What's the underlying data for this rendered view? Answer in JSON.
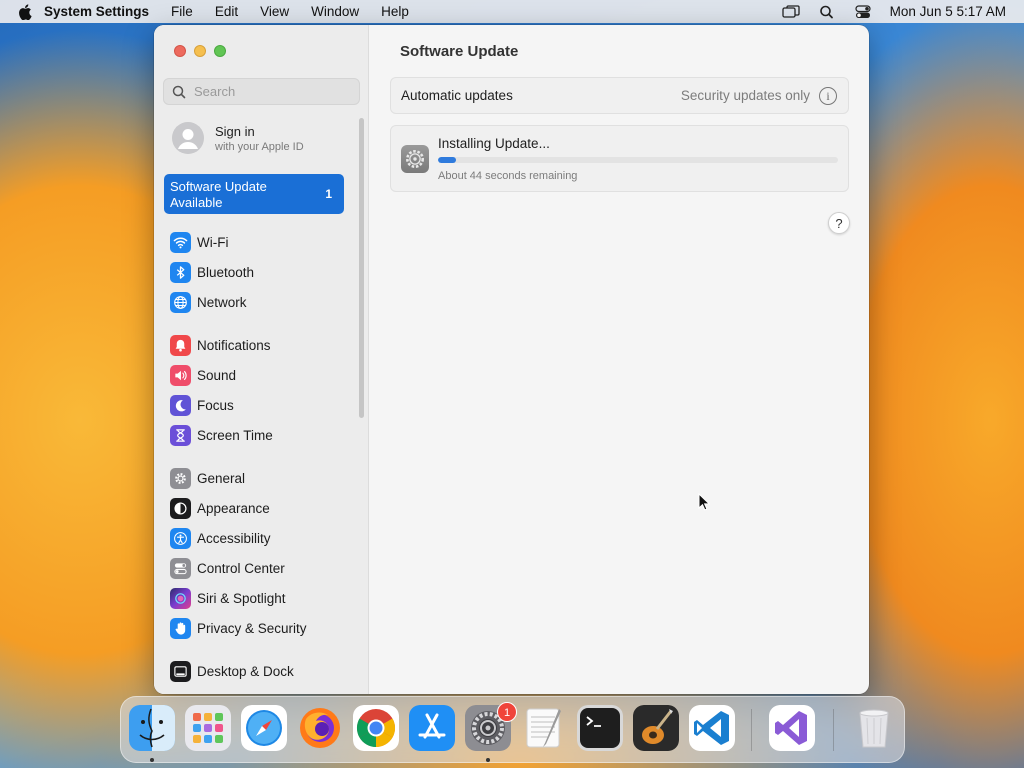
{
  "menubar": {
    "app_name": "System Settings",
    "menus": [
      "File",
      "Edit",
      "View",
      "Window",
      "Help"
    ],
    "clock": "Mon Jun 5  5:17 AM"
  },
  "sidebar": {
    "search_placeholder": "Search",
    "signin_title": "Sign in",
    "signin_subtitle": "with your Apple ID",
    "update_label_line1": "Software Update",
    "update_label_line2": "Available",
    "update_badge": "1",
    "items": [
      {
        "label": "Wi-Fi",
        "icon": "wifi-icon",
        "color": "#1f86f0"
      },
      {
        "label": "Bluetooth",
        "icon": "bluetooth-icon",
        "color": "#1f86f0"
      },
      {
        "label": "Network",
        "icon": "globe-icon",
        "color": "#1f86f0"
      },
      {
        "label": "Notifications",
        "icon": "bell-icon",
        "color": "#f0484a"
      },
      {
        "label": "Sound",
        "icon": "speaker-icon",
        "color": "#ef4d6a"
      },
      {
        "label": "Focus",
        "icon": "moon-icon",
        "color": "#6053d6"
      },
      {
        "label": "Screen Time",
        "icon": "hourglass-icon",
        "color": "#6b4fd8"
      },
      {
        "label": "General",
        "icon": "gear-icon",
        "color": "#8e8e93"
      },
      {
        "label": "Appearance",
        "icon": "appearance-icon",
        "color": "#1c1c1e"
      },
      {
        "label": "Accessibility",
        "icon": "accessibility-icon",
        "color": "#1f86f0"
      },
      {
        "label": "Control Center",
        "icon": "toggles-icon",
        "color": "#8e8e93"
      },
      {
        "label": "Siri & Spotlight",
        "icon": "siri-icon",
        "color": "#5a3fd0"
      },
      {
        "label": "Privacy & Security",
        "icon": "hand-icon",
        "color": "#1f86f0"
      },
      {
        "label": "Desktop & Dock",
        "icon": "dock-icon",
        "color": "#1c1c1e"
      }
    ]
  },
  "main": {
    "title": "Software Update",
    "automatic_updates_label": "Automatic updates",
    "automatic_updates_value": "Security updates only",
    "install_title": "Installing Update...",
    "install_remaining": "About 44 seconds remaining",
    "install_progress": 0.045,
    "help_label": "?"
  },
  "dock": {
    "apps": [
      {
        "name": "Finder",
        "icon": "finder-icon",
        "running": true
      },
      {
        "name": "Launchpad",
        "icon": "launchpad-icon",
        "running": false
      },
      {
        "name": "Safari",
        "icon": "safari-icon",
        "running": false
      },
      {
        "name": "Firefox",
        "icon": "firefox-icon",
        "running": false
      },
      {
        "name": "Google Chrome",
        "icon": "chrome-icon",
        "running": false
      },
      {
        "name": "App Store",
        "icon": "app-store-icon",
        "running": false
      },
      {
        "name": "System Settings",
        "icon": "system-settings-icon",
        "running": true,
        "badge": "1"
      },
      {
        "name": "TextEdit",
        "icon": "textedit-icon",
        "running": false
      },
      {
        "name": "Terminal",
        "icon": "terminal-icon",
        "running": false
      },
      {
        "name": "GarageBand",
        "icon": "garageband-icon",
        "running": false
      },
      {
        "name": "Visual Studio Code",
        "icon": "vscode-icon",
        "running": false
      },
      {
        "name": "Visual Studio",
        "icon": "visual-studio-icon",
        "running": false
      },
      {
        "name": "Trash",
        "icon": "trash-icon",
        "running": false
      }
    ]
  }
}
